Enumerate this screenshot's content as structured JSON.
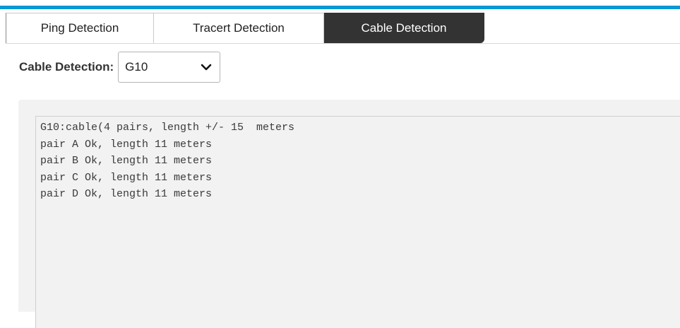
{
  "tabs": [
    {
      "label": "Ping Detection",
      "active": false
    },
    {
      "label": "Tracert Detection",
      "active": false
    },
    {
      "label": "Cable Detection",
      "active": true
    }
  ],
  "colors": {
    "accent": "#0b97d4",
    "active_tab_bg": "#333333",
    "output_bg": "#f2f2f2"
  },
  "selector": {
    "label": "Cable Detection:",
    "selected_port": "G10",
    "icon": "chevron-down-icon"
  },
  "output": {
    "lines": [
      "G10:cable(4 pairs, length +/- 15  meters",
      "pair A Ok, length 11 meters",
      "pair B Ok, length 11 meters",
      "pair C Ok, length 11 meters",
      "pair D Ok, length 11 meters"
    ]
  }
}
